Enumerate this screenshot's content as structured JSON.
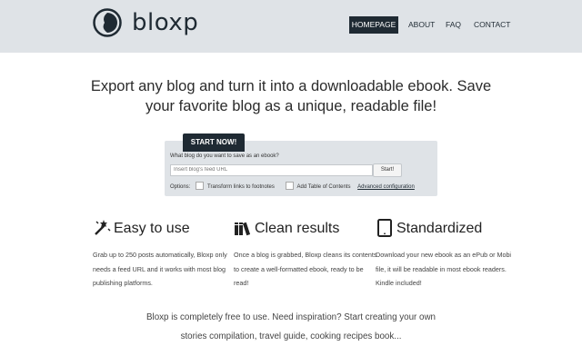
{
  "header": {
    "brand": "bloxp",
    "nav": [
      {
        "label": "HOMEPAGE"
      },
      {
        "label": "ABOUT"
      },
      {
        "label": "FAQ"
      },
      {
        "label": "CONTACT"
      }
    ]
  },
  "hero": {
    "line1": "Export any blog and turn it into a downloadable ebook. Save",
    "line2": "your favorite blog as a unique, readable file!"
  },
  "form": {
    "tab_label": "START NOW!",
    "question": "What blog do you want to save as an ebook?",
    "feed_placeholder": "Insert blog's feed URL",
    "feed_value": "",
    "start_label": "Start!",
    "options_label": "Options:",
    "opt_footnotes": "Transform links to footnotes",
    "opt_toc": "Add Table of Contents",
    "advanced": "Advanced configuration"
  },
  "features": [
    {
      "icon": "magic-wand-icon",
      "title": "Easy to use",
      "text": "Grab up to 250 posts automatically, Bloxp only needs a feed URL and it works with most blog publishing platforms."
    },
    {
      "icon": "books-icon",
      "title": "Clean results",
      "text": "Once a blog is grabbed, Bloxp cleans its contents to create a well-formatted ebook, ready to be read!"
    },
    {
      "icon": "tablet-icon",
      "title": "Standardized",
      "text": "Download your new ebook as an ePub or Mobi file, it will be readable in most ebook readers. Kindle included!"
    }
  ],
  "footer": {
    "line1": "Bloxp is completely free to use. Need inspiration? Start creating your own",
    "line2": "stories compilation, travel guide, cooking recipes book..."
  },
  "colors": {
    "dark": "#1f2a33",
    "header_bg": "#dfe3e7"
  }
}
